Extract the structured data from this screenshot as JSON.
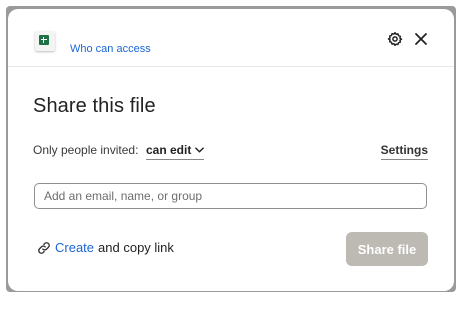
{
  "header": {
    "file_icon": "spreadsheet-file-icon",
    "who_can_access": "Who can access",
    "settings_icon": "gear-icon",
    "close_icon": "close-icon"
  },
  "main": {
    "title": "Share this file",
    "permission_prefix": "Only people invited:",
    "permission_value": "can edit",
    "settings_label": "Settings",
    "input_placeholder": "Add an email, name, or group",
    "input_value": "",
    "link_icon": "link-icon",
    "create_label": "Create",
    "copy_link_label": "and copy link",
    "share_button": "Share file"
  },
  "colors": {
    "accent": "#1a66d6",
    "share_button_disabled": "#bdb9b3",
    "excel_green": "#1e7145"
  }
}
